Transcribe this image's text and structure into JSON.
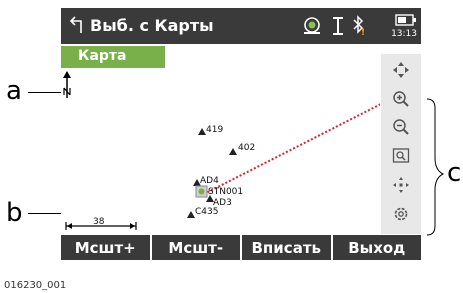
{
  "titlebar": {
    "title": "Выб. с Карты",
    "clock": "13:13"
  },
  "tab": {
    "label": "Карта"
  },
  "map": {
    "points": [
      {
        "id": "419",
        "label": "419"
      },
      {
        "id": "402",
        "label": "402"
      },
      {
        "id": "AD4",
        "label": "AD4"
      },
      {
        "id": "STN001",
        "label": "STN001"
      },
      {
        "id": "AD3",
        "label": "AD3"
      },
      {
        "id": "C435",
        "label": "C435"
      }
    ],
    "scale_value": "38",
    "north_label": "N"
  },
  "toolbar": {
    "tools": [
      "pan-icon",
      "zoom-in-icon",
      "zoom-out-icon",
      "zoom-window-icon",
      "fit-all-icon",
      "settings-icon"
    ]
  },
  "softkeys": [
    "Мсшт+",
    "Мсшт-",
    "Вписать",
    "Выход"
  ],
  "callouts": {
    "a": "a",
    "b": "b",
    "c": "c"
  },
  "footnote": "016230_001",
  "colors": {
    "titlebar_bg": "#3a3a3a",
    "tab_bg": "#79b04a",
    "line": "#e0202a",
    "toolbar_bg": "#e8e8e8"
  }
}
